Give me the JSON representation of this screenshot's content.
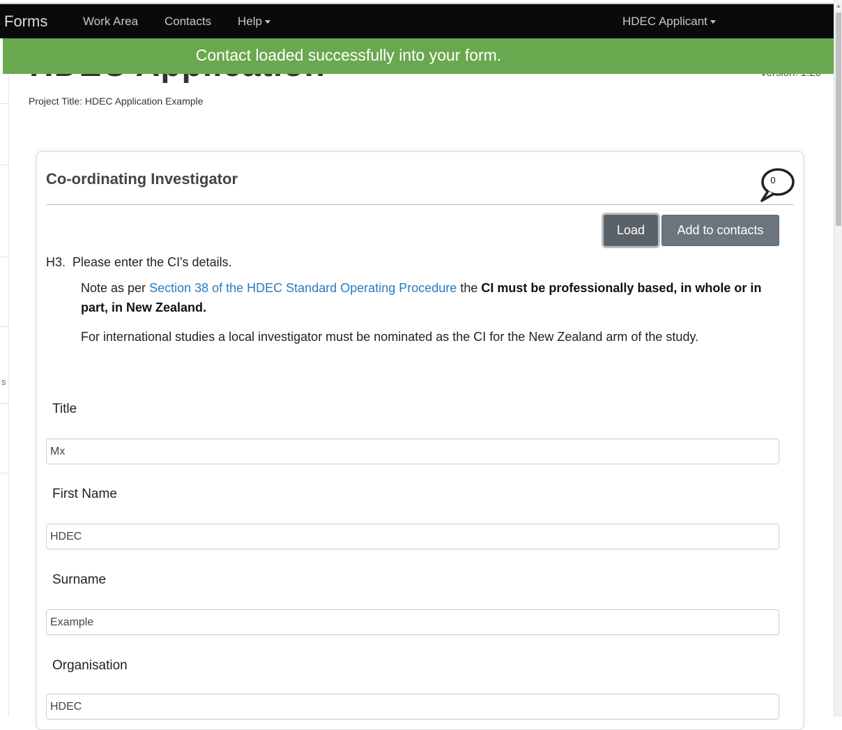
{
  "navbar": {
    "brand": "Forms",
    "links": [
      "Work Area",
      "Contacts",
      "Help"
    ],
    "user_menu": "HDEC Applicant"
  },
  "alert": {
    "message": "Contact loaded successfully into your form."
  },
  "page": {
    "heading": "HDEC Application",
    "version": "Version: 1.20",
    "project_title": "Project Title: HDEC Application Example"
  },
  "sidebar": {
    "partial_letter": "s"
  },
  "panel": {
    "title": "Co-ordinating Investigator",
    "comment_count": "0",
    "buttons": {
      "load": "Load",
      "add_to_contacts": "Add to contacts"
    },
    "question": "H3.  Please enter the CI's details.",
    "note1": {
      "prefix": "Note as per ",
      "link": "Section 38 of the HDEC Standard Operating Procedure",
      "middle": " the ",
      "bold": "CI must be professionally based, in whole or in part, in New Zealand."
    },
    "note2": "For international studies a local investigator must be nominated as the CI for the New Zealand arm of the study.",
    "fields": [
      {
        "label": "Title",
        "value": "Mx"
      },
      {
        "label": "First Name",
        "value": "HDEC"
      },
      {
        "label": "Surname",
        "value": "Example"
      },
      {
        "label": "Organisation",
        "value": "HDEC"
      }
    ]
  }
}
